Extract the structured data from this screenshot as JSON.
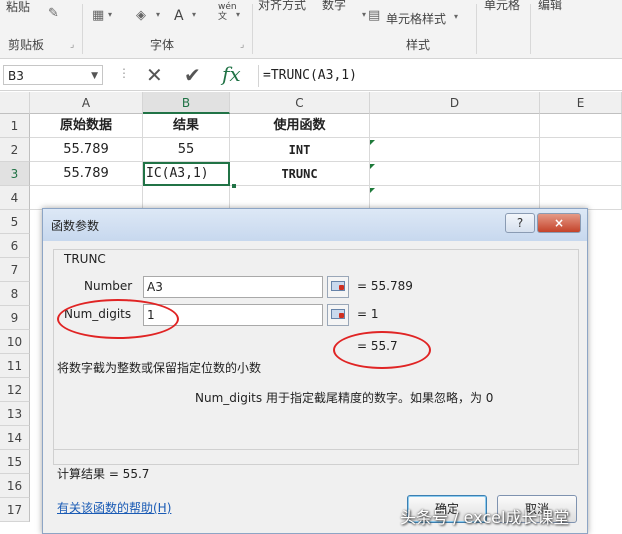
{
  "ribbon": {
    "paste": "粘贴",
    "clipboard": "剪贴板",
    "font": "字体",
    "align": "对齐方式",
    "number": "数字",
    "cell_style": "单元格样式",
    "styles": "样式",
    "cells": "单元格",
    "editing": "编辑",
    "font_color_glyph": "A",
    "wen_glyph": "wén\n文"
  },
  "formula_bar": {
    "name_box": "B3",
    "fx": "fx",
    "formula": "=TRUNC(A3,1)"
  },
  "grid": {
    "columns": [
      "A",
      "B",
      "C",
      "D",
      "E"
    ],
    "rows": [
      "1",
      "2",
      "3",
      "4",
      "5",
      "6",
      "7",
      "8",
      "9",
      "10",
      "11",
      "12",
      "13",
      "14",
      "15",
      "16",
      "17"
    ],
    "cells": {
      "a1": "原始数据",
      "b1": "结果",
      "c1": "使用函数",
      "a2": "55.789",
      "b2": "55",
      "c2": "INT",
      "a3": "55.789",
      "b3": "IC(A3,1)",
      "c3": "TRUNC"
    }
  },
  "dialog": {
    "title": "函数参数",
    "help_btn": "?",
    "close_btn": "×",
    "func_name": "TRUNC",
    "args": [
      {
        "label": "Number",
        "value": "A3",
        "result": "=  55.789"
      },
      {
        "label": "Num_digits",
        "value": "1",
        "result": "=  1"
      }
    ],
    "total": "=  55.7",
    "description": "将数字截为整数或保留指定位数的小数",
    "arg_help": "Num_digits  用于指定截尾精度的数字。如果忽略，为 0",
    "calc_result": "计算结果 =  55.7",
    "help_link": "有关该函数的帮助(H)",
    "ok": "确定",
    "cancel": "取消"
  },
  "watermark": "头条号 / excel成长课堂",
  "colors": {
    "accent": "#217346",
    "annotation": "#e02424",
    "link": "#1a5bb5"
  }
}
